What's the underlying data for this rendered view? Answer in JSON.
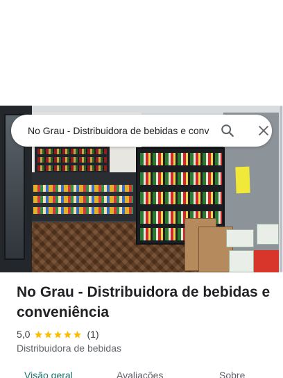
{
  "search": {
    "query": "No Grau - Distribuidora de bebidas e conveniência",
    "search_icon": "search-icon",
    "close_icon": "close-icon"
  },
  "hero_photo": {
    "alt": "store-interior-photo"
  },
  "place": {
    "title": "No Grau - Distribuidora de bebidas e conveniência",
    "rating": "5,0",
    "stars": 5,
    "review_count": "(1)",
    "category": "Distribuidora de bebidas"
  },
  "tabs": [
    {
      "label": "Visão geral",
      "active": true
    },
    {
      "label": "Avaliações",
      "active": false
    },
    {
      "label": "Sobre",
      "active": false
    }
  ],
  "colors": {
    "star": "#fbbc04",
    "active_tab": "#1a7370",
    "secondary_text": "#5f6368"
  }
}
